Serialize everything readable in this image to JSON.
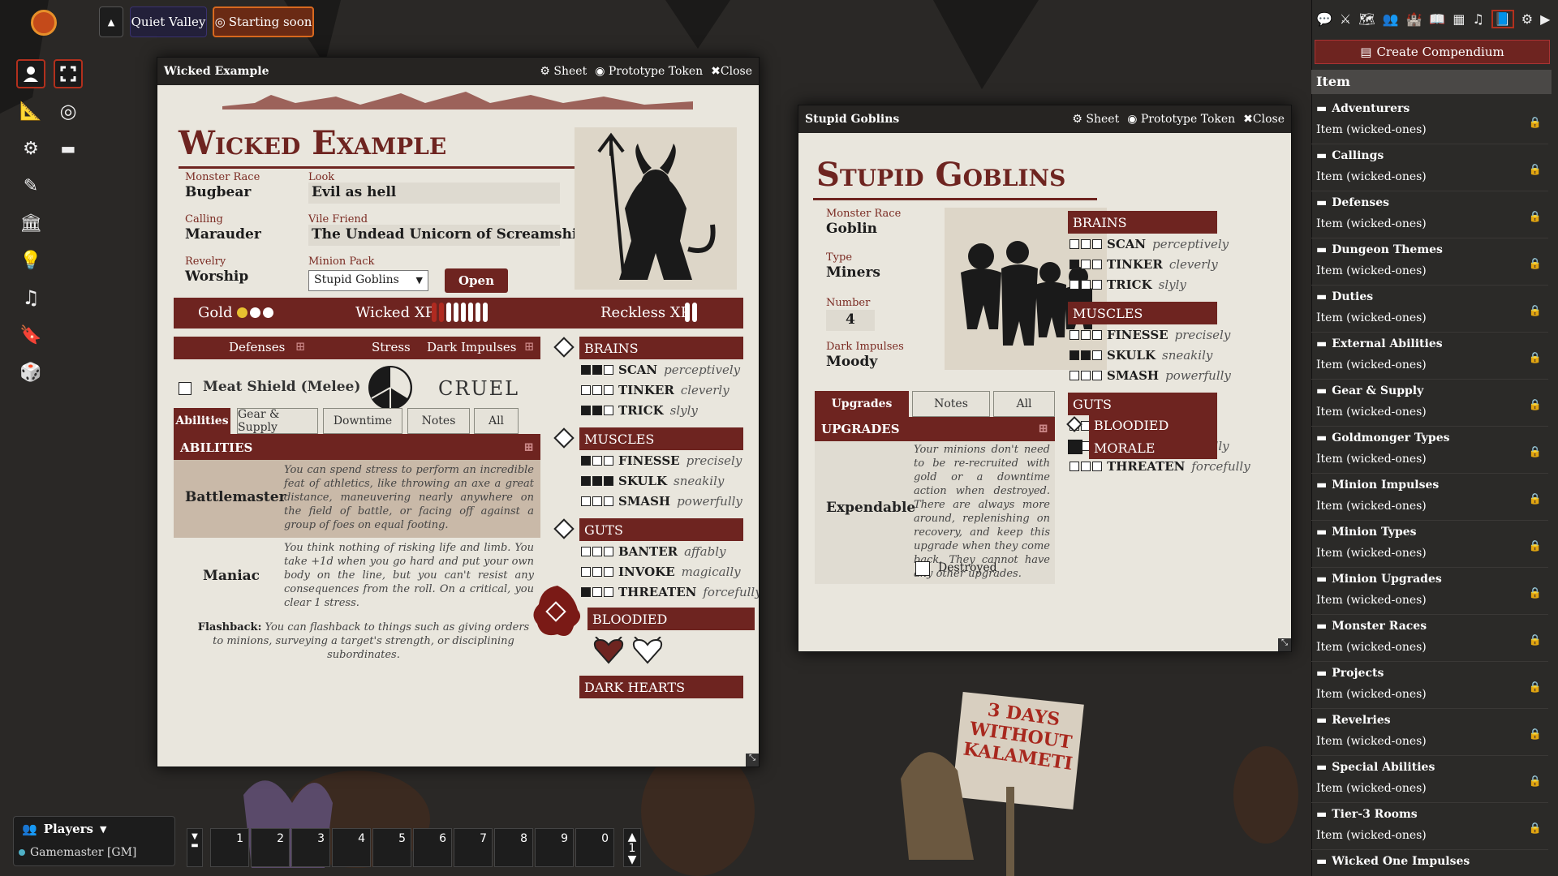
{
  "scene_nav": {
    "scene_name": "Quiet Valley",
    "status": "Starting soon"
  },
  "left_toolbar": [
    "token-controls",
    "fullscreen",
    "measure",
    "target",
    "tiles",
    "ruler",
    "draw",
    "walls",
    "lighting",
    "sounds",
    "notes",
    "dice"
  ],
  "players": {
    "title": "Players",
    "gm": "Gamemaster [GM]"
  },
  "hotbar": {
    "slots": [
      "1",
      "2",
      "3",
      "4",
      "5",
      "6",
      "7",
      "8",
      "9",
      "0"
    ],
    "page": "1"
  },
  "wicked": {
    "window_title": "Wicked Example",
    "controls": {
      "sheet": "Sheet",
      "token": "Prototype Token",
      "close": "Close"
    },
    "name": "Wicked Example",
    "monster_race_label": "Monster Race",
    "monster_race": "Bugbear",
    "look_label": "Look",
    "look": "Evil as hell",
    "calling_label": "Calling",
    "calling": "Marauder",
    "vile_friend_label": "Vile Friend",
    "vile_friend": "The Undead Unicorn of Screamshire",
    "revelry_label": "Revelry",
    "revelry": "Worship",
    "minion_pack_label": "Minion Pack",
    "minion_pack": "Stupid Goblins",
    "open_label": "Open",
    "gold_label": "Gold",
    "wicked_xp_label": "Wicked XP",
    "reckless_xp_label": "Reckless XP",
    "defenses_label": "Defenses",
    "stress_label": "Stress",
    "dark_impulses_label": "Dark Impulses",
    "defense_item": "Meat Shield (Melee)",
    "impulse_value": "CRUEL",
    "tabs": [
      "Abilities",
      "Gear & Supply",
      "Downtime",
      "Notes",
      "All"
    ],
    "abilities_header": "ABILITIES",
    "abilities": [
      {
        "name": "Battlemaster",
        "desc": "You can spend stress to perform an incredible feat of athletics, like throwing an axe a great distance, maneuvering nearly anywhere on the field of battle, or facing off against a group of foes on equal footing."
      },
      {
        "name": "Maniac",
        "desc": "You think nothing of risking life and limb. You take +1d when you go hard and put your own body on the line, but you can't resist any consequences from the roll. On a critical, you clear 1 stress."
      }
    ],
    "flashback_label": "Flashback:",
    "flashback": "You can flashback to things such as giving orders to minions, surveying a target's strength, or disciplining subordinates.",
    "attributes": [
      {
        "name": "BRAINS",
        "actions": [
          {
            "n": "SCAN",
            "a": "perceptively",
            "v": 2
          },
          {
            "n": "TINKER",
            "a": "cleverly",
            "v": 0
          },
          {
            "n": "TRICK",
            "a": "slyly",
            "v": 2
          }
        ]
      },
      {
        "name": "MUSCLES",
        "actions": [
          {
            "n": "FINESSE",
            "a": "precisely",
            "v": 1
          },
          {
            "n": "SKULK",
            "a": "sneakily",
            "v": 3
          },
          {
            "n": "SMASH",
            "a": "powerfully",
            "v": 0
          }
        ]
      },
      {
        "name": "GUTS",
        "actions": [
          {
            "n": "BANTER",
            "a": "affably",
            "v": 0
          },
          {
            "n": "INVOKE",
            "a": "magically",
            "v": 0
          },
          {
            "n": "THREATEN",
            "a": "forcefully",
            "v": 1
          }
        ]
      }
    ],
    "bloodied": "BLOODIED",
    "dark_hearts": "DARK HEARTS"
  },
  "goblins": {
    "window_title": "Stupid Goblins",
    "controls": {
      "sheet": "Sheet",
      "token": "Prototype Token",
      "close": "Close"
    },
    "name": "Stupid Goblins",
    "monster_race_label": "Monster Race",
    "monster_race": "Goblin",
    "type_label": "Type",
    "type": "Miners",
    "number_label": "Number",
    "number": "4",
    "dark_impulses_label": "Dark Impulses",
    "dark_impulses": "Moody",
    "tabs": [
      "Upgrades",
      "Notes",
      "All"
    ],
    "upgrades_header": "UPGRADES",
    "upgrade": {
      "name": "Expendable",
      "desc": "Your minions don't need to be re-recruited with gold or a downtime action when destroyed. There are always more around, replenishing on recovery, and keep this upgrade when they come back. They cannot have any other upgrades.",
      "destroyed_label": "Destroyed"
    },
    "attributes": [
      {
        "name": "BRAINS",
        "actions": [
          {
            "n": "SCAN",
            "a": "perceptively",
            "v": 0
          },
          {
            "n": "TINKER",
            "a": "cleverly",
            "v": 1
          },
          {
            "n": "TRICK",
            "a": "slyly",
            "v": 0
          }
        ]
      },
      {
        "name": "MUSCLES",
        "actions": [
          {
            "n": "FINESSE",
            "a": "precisely",
            "v": 0
          },
          {
            "n": "SKULK",
            "a": "sneakily",
            "v": 2
          },
          {
            "n": "SMASH",
            "a": "powerfully",
            "v": 0
          }
        ]
      },
      {
        "name": "GUTS",
        "actions": [
          {
            "n": "BANTER",
            "a": "affably",
            "v": 0
          },
          {
            "n": "INVOKE",
            "a": "magically",
            "v": 0
          },
          {
            "n": "THREATEN",
            "a": "forcefully",
            "v": 0
          }
        ]
      }
    ],
    "bloodied": "BLOODIED",
    "morale": "MORALE"
  },
  "compendium": {
    "create_label": "Create Compendium",
    "section": "Item",
    "items": [
      {
        "name": "Adventurers",
        "sub": "Item (wicked-ones)"
      },
      {
        "name": "Callings",
        "sub": "Item (wicked-ones)"
      },
      {
        "name": "Defenses",
        "sub": "Item (wicked-ones)"
      },
      {
        "name": "Dungeon Themes",
        "sub": "Item (wicked-ones)"
      },
      {
        "name": "Duties",
        "sub": "Item (wicked-ones)"
      },
      {
        "name": "External Abilities",
        "sub": "Item (wicked-ones)"
      },
      {
        "name": "Gear & Supply",
        "sub": "Item (wicked-ones)"
      },
      {
        "name": "Goldmonger Types",
        "sub": "Item (wicked-ones)"
      },
      {
        "name": "Minion Impulses",
        "sub": "Item (wicked-ones)"
      },
      {
        "name": "Minion Types",
        "sub": "Item (wicked-ones)"
      },
      {
        "name": "Minion Upgrades",
        "sub": "Item (wicked-ones)"
      },
      {
        "name": "Monster Races",
        "sub": "Item (wicked-ones)"
      },
      {
        "name": "Projects",
        "sub": "Item (wicked-ones)"
      },
      {
        "name": "Revelries",
        "sub": "Item (wicked-ones)"
      },
      {
        "name": "Special Abilities",
        "sub": "Item (wicked-ones)"
      },
      {
        "name": "Tier-3 Rooms",
        "sub": "Item (wicked-ones)"
      },
      {
        "name": "Wicked One Impulses",
        "sub": ""
      }
    ]
  },
  "sign_text": "3 DAYS WITHOUT KALAMETI"
}
